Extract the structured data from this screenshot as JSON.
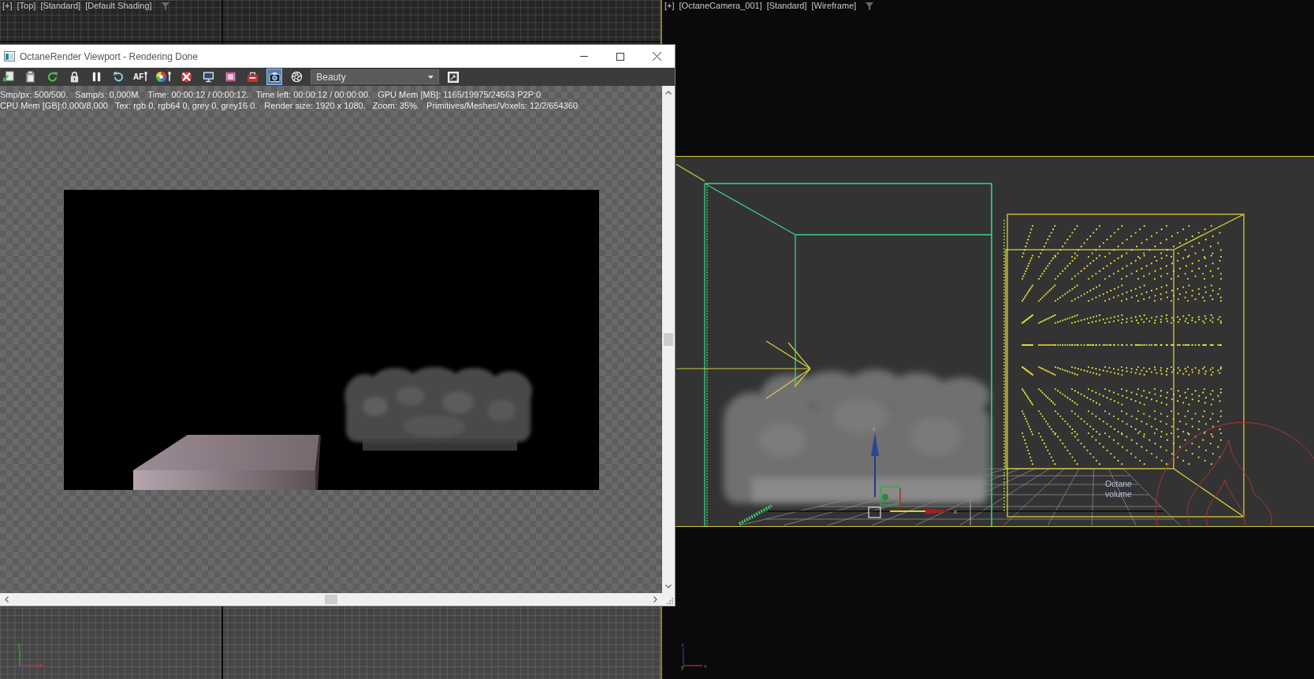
{
  "top_viewport": {
    "label_menus": [
      "[+]",
      "[Top]",
      "[Standard]",
      "[Default Shading]"
    ],
    "axis_tripod": {
      "vertical": "y",
      "origin": "z"
    }
  },
  "camera_viewport": {
    "label_menus": [
      "[+]",
      "[OctaneCamera_001]",
      "[Standard]",
      "[Wireframe]"
    ],
    "scene": {
      "volume_label": "Octane volume",
      "gizmo_axes": {
        "vertical": "z",
        "horizontal": "x"
      }
    },
    "axis_tripod": {
      "vertical": "z",
      "origin": "y",
      "horizontal": "x"
    }
  },
  "render_window": {
    "title": "OctaneRender Viewport - Rendering Done",
    "toolbar": {
      "buttons": [
        {
          "kind": "export",
          "selected": false
        },
        {
          "kind": "copy",
          "selected": false
        },
        {
          "kind": "refresh",
          "selected": false
        },
        {
          "kind": "lock",
          "selected": false
        },
        {
          "kind": "pause",
          "selected": false
        },
        {
          "kind": "restart",
          "selected": false
        },
        {
          "kind": "focus",
          "label": "AF",
          "selected": false
        },
        {
          "kind": "color",
          "selected": false
        },
        {
          "kind": "region",
          "selected": false
        },
        {
          "kind": "display",
          "selected": false
        },
        {
          "kind": "film",
          "selected": false
        },
        {
          "kind": "imager",
          "selected": false
        },
        {
          "kind": "camera",
          "selected": true
        },
        {
          "kind": "aperture",
          "selected": false
        }
      ],
      "pass_dropdown": {
        "value": "Beauty"
      },
      "end_buttons": [
        {
          "kind": "export-image",
          "selected": false
        }
      ]
    },
    "status_lines": [
      [
        "Smp/px: 500/500.",
        "Samp/s: 0,000M.",
        "Time: 00:00:12 / 00:00:12.",
        "Time left: 00:00:12 / 00:00:00.",
        "GPU Mem [MB]: 1165/19975/24563 P2P:0"
      ],
      [
        "CPU Mem [GB]:0,000/8,000",
        "Tex: rgb 0, rgb64 0, grey 0, grey16 0.",
        "Render size: 1920 x 1080.",
        "Zoom: 35%.",
        "Primitives/Meshes/Voxels: 12/2/654360"
      ]
    ]
  }
}
